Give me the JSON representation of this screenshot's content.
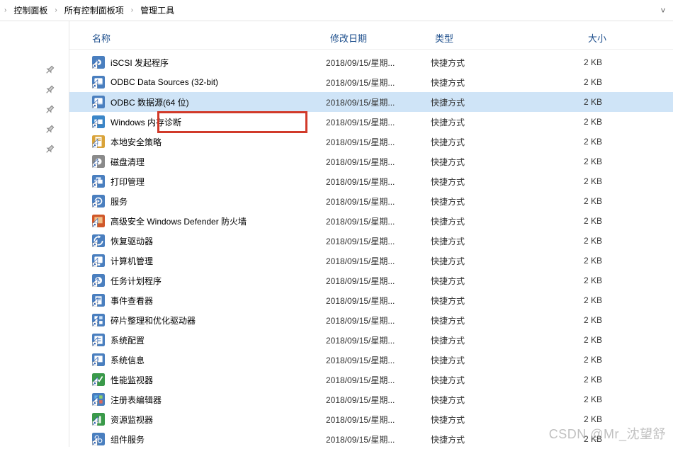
{
  "breadcrumbs": [
    "控制面板",
    "所有控制面板项",
    "管理工具"
  ],
  "columns": {
    "name": "名称",
    "date": "修改日期",
    "type": "类型",
    "size": "大小"
  },
  "pins_count": 5,
  "highlight_index": 2,
  "rows": [
    {
      "icon": "iscsi",
      "name": "iSCSI 发起程序",
      "date": "2018/09/15/星期...",
      "type": "快捷方式",
      "size": "2 KB"
    },
    {
      "icon": "odbc",
      "name": "ODBC Data Sources (32-bit)",
      "date": "2018/09/15/星期...",
      "type": "快捷方式",
      "size": "2 KB"
    },
    {
      "icon": "odbc",
      "name": "ODBC 数据源(64 位)",
      "date": "2018/09/15/星期...",
      "type": "快捷方式",
      "size": "2 KB",
      "selected": true
    },
    {
      "icon": "mem",
      "name": "Windows 内存诊断",
      "date": "2018/09/15/星期...",
      "type": "快捷方式",
      "size": "2 KB"
    },
    {
      "icon": "secpol",
      "name": "本地安全策略",
      "date": "2018/09/15/星期...",
      "type": "快捷方式",
      "size": "2 KB"
    },
    {
      "icon": "disk",
      "name": "磁盘清理",
      "date": "2018/09/15/星期...",
      "type": "快捷方式",
      "size": "2 KB"
    },
    {
      "icon": "print",
      "name": "打印管理",
      "date": "2018/09/15/星期...",
      "type": "快捷方式",
      "size": "2 KB"
    },
    {
      "icon": "services",
      "name": "服务",
      "date": "2018/09/15/星期...",
      "type": "快捷方式",
      "size": "2 KB"
    },
    {
      "icon": "defender",
      "name": "高级安全 Windows Defender 防火墙",
      "date": "2018/09/15/星期...",
      "type": "快捷方式",
      "size": "2 KB"
    },
    {
      "icon": "recovery",
      "name": "恢复驱动器",
      "date": "2018/09/15/星期...",
      "type": "快捷方式",
      "size": "2 KB"
    },
    {
      "icon": "compmgmt",
      "name": "计算机管理",
      "date": "2018/09/15/星期...",
      "type": "快捷方式",
      "size": "2 KB"
    },
    {
      "icon": "tasks",
      "name": "任务计划程序",
      "date": "2018/09/15/星期...",
      "type": "快捷方式",
      "size": "2 KB"
    },
    {
      "icon": "events",
      "name": "事件查看器",
      "date": "2018/09/15/星期...",
      "type": "快捷方式",
      "size": "2 KB"
    },
    {
      "icon": "defrag",
      "name": "碎片整理和优化驱动器",
      "date": "2018/09/15/星期...",
      "type": "快捷方式",
      "size": "2 KB"
    },
    {
      "icon": "syscfg",
      "name": "系统配置",
      "date": "2018/09/15/星期...",
      "type": "快捷方式",
      "size": "2 KB"
    },
    {
      "icon": "sysinfo",
      "name": "系统信息",
      "date": "2018/09/15/星期...",
      "type": "快捷方式",
      "size": "2 KB"
    },
    {
      "icon": "perfmon",
      "name": "性能监视器",
      "date": "2018/09/15/星期...",
      "type": "快捷方式",
      "size": "2 KB"
    },
    {
      "icon": "regedit",
      "name": "注册表编辑器",
      "date": "2018/09/15/星期...",
      "type": "快捷方式",
      "size": "2 KB"
    },
    {
      "icon": "resmon",
      "name": "资源监视器",
      "date": "2018/09/15/星期...",
      "type": "快捷方式",
      "size": "2 KB"
    },
    {
      "icon": "compsvc",
      "name": "组件服务",
      "date": "2018/09/15/星期...",
      "type": "快捷方式",
      "size": "2 KB"
    }
  ],
  "watermark": "CSDN @Mr_沈望舒"
}
